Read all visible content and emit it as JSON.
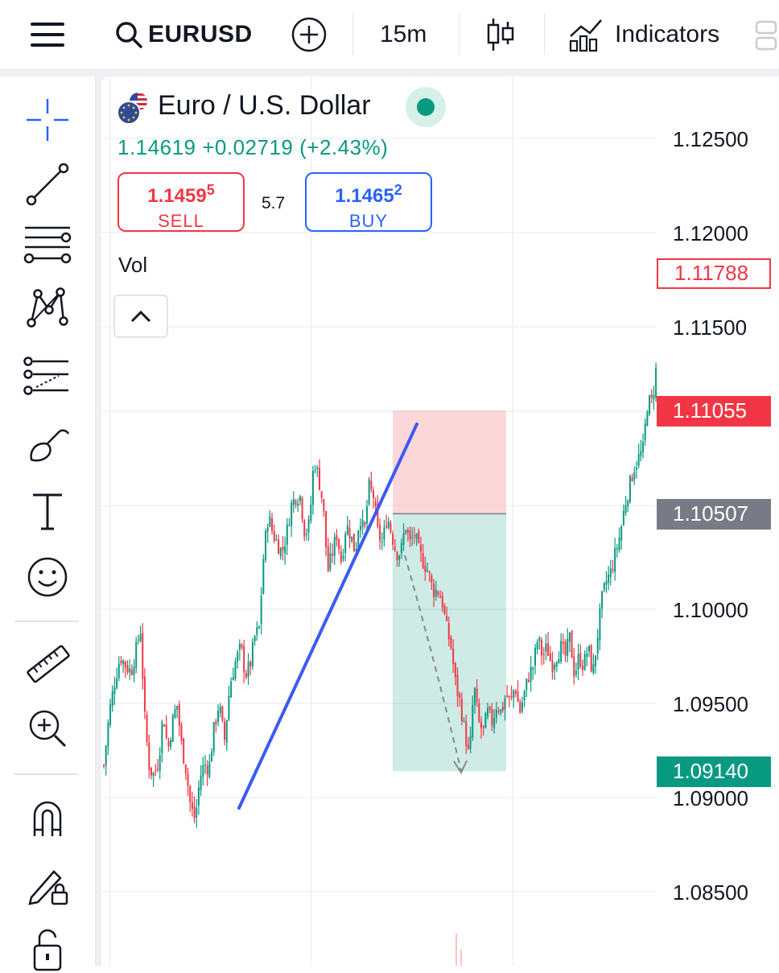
{
  "toolbar": {
    "symbol": "EURUSD",
    "timeframe": "15m",
    "indicators_label": "Indicators"
  },
  "legend": {
    "title": "Euro / U.S. Dollar",
    "last_price": "1.14619",
    "change": "+0.02719",
    "change_pct": "(+2.43%)",
    "price_line": "1.14619  +0.02719 (+2.43%)",
    "status_color": "#089981"
  },
  "order_panel": {
    "sell_price_main": "1.1459",
    "sell_price_pip": "5",
    "sell_label": "SELL",
    "spread": "5.7",
    "buy_price_main": "1.1465",
    "buy_price_pip": "2",
    "buy_label": "BUY",
    "sell_color": "#f23645",
    "buy_color": "#2962ff"
  },
  "volume_label": "Vol",
  "sidebar_tools": [
    "crosshair-icon",
    "trend-line-icon",
    "fib-retracement-icon",
    "xabcd-pattern-icon",
    "gann-fan-icon",
    "brush-icon",
    "text-icon",
    "emoji-icon",
    "ruler-icon",
    "zoom-in-icon",
    "magnet-icon",
    "lock-drawing-icon",
    "unlock-icon"
  ],
  "price_axis": {
    "labels": [
      "1.12500",
      "1.12000",
      "1.11500",
      "1.10000",
      "1.09500",
      "1.09000",
      "1.08500"
    ]
  },
  "price_tags": {
    "current": "1.11788",
    "stop_loss": "1.11055",
    "entry": "1.10507",
    "take_profit": "1.09140"
  },
  "colors": {
    "bull": "#089981",
    "bear": "#f23645",
    "drawing_line": "#3b5bf0"
  },
  "chart_data": {
    "type": "candlestick",
    "symbol": "EURUSD",
    "timeframe": "15m",
    "ylim": [
      1.0825,
      1.1285
    ],
    "ticks": [
      1.125,
      1.12,
      1.115,
      1.1,
      1.095,
      1.09,
      1.085
    ],
    "close_path": [
      [
        0,
        1.0917
      ],
      [
        6,
        1.0945
      ],
      [
        12,
        1.0962
      ],
      [
        18,
        1.0975
      ],
      [
        24,
        1.097
      ],
      [
        30,
        1.0967
      ],
      [
        36,
        1.098
      ],
      [
        40,
        1.099
      ],
      [
        45,
        1.094
      ],
      [
        50,
        1.0915
      ],
      [
        55,
        1.0912
      ],
      [
        60,
        1.092
      ],
      [
        65,
        1.0945
      ],
      [
        70,
        1.0925
      ],
      [
        75,
        1.094
      ],
      [
        80,
        1.095
      ],
      [
        85,
        1.0928
      ],
      [
        90,
        1.0915
      ],
      [
        95,
        1.0895
      ],
      [
        100,
        1.0888
      ],
      [
        105,
        1.091
      ],
      [
        110,
        1.0918
      ],
      [
        115,
        1.0915
      ],
      [
        120,
        1.0935
      ],
      [
        126,
        1.095
      ],
      [
        132,
        1.093
      ],
      [
        138,
        1.096
      ],
      [
        144,
        1.0972
      ],
      [
        150,
        1.098
      ],
      [
        155,
        1.0965
      ],
      [
        160,
        1.097
      ],
      [
        165,
        1.0985
      ],
      [
        170,
        1.099
      ],
      [
        175,
        1.103
      ],
      [
        180,
        1.105
      ],
      [
        185,
        1.104
      ],
      [
        190,
        1.1035
      ],
      [
        195,
        1.103
      ],
      [
        200,
        1.104
      ],
      [
        205,
        1.1055
      ],
      [
        210,
        1.106
      ],
      [
        215,
        1.106
      ],
      [
        220,
        1.104
      ],
      [
        225,
        1.1045
      ],
      [
        230,
        1.108
      ],
      [
        235,
        1.107
      ],
      [
        240,
        1.1055
      ],
      [
        245,
        1.102
      ],
      [
        250,
        1.103
      ],
      [
        255,
        1.104
      ],
      [
        260,
        1.1025
      ],
      [
        265,
        1.1045
      ],
      [
        270,
        1.104
      ],
      [
        275,
        1.103
      ],
      [
        280,
        1.105
      ],
      [
        285,
        1.104
      ],
      [
        290,
        1.1065
      ],
      [
        295,
        1.106
      ],
      [
        300,
        1.104
      ],
      [
        305,
        1.1035
      ],
      [
        310,
        1.105
      ],
      [
        315,
        1.104
      ],
      [
        320,
        1.103
      ],
      [
        325,
        1.103
      ],
      [
        330,
        1.1045
      ],
      [
        335,
        1.1035
      ],
      [
        340,
        1.104
      ],
      [
        345,
        1.103
      ],
      [
        350,
        1.1025
      ],
      [
        355,
        1.102
      ],
      [
        360,
        1.101
      ],
      [
        365,
        1.101
      ],
      [
        370,
        1.1005
      ],
      [
        375,
        1.099
      ],
      [
        380,
        1.098
      ],
      [
        385,
        1.096
      ],
      [
        390,
        1.095
      ],
      [
        395,
        1.0935
      ],
      [
        400,
        1.092
      ],
      [
        405,
        1.096
      ],
      [
        410,
        1.094
      ],
      [
        415,
        1.0935
      ],
      [
        420,
        1.0945
      ],
      [
        425,
        1.094
      ],
      [
        430,
        1.095
      ],
      [
        435,
        1.0945
      ],
      [
        440,
        1.0955
      ],
      [
        445,
        1.095
      ],
      [
        450,
        1.096
      ],
      [
        455,
        1.0945
      ],
      [
        460,
        1.0955
      ],
      [
        465,
        1.0965
      ],
      [
        470,
        1.097
      ],
      [
        475,
        1.0985
      ],
      [
        480,
        1.0975
      ],
      [
        485,
        1.098
      ],
      [
        490,
        1.097
      ],
      [
        495,
        1.0975
      ],
      [
        500,
        1.098
      ],
      [
        505,
        1.0975
      ],
      [
        510,
        1.0985
      ],
      [
        515,
        1.0965
      ],
      [
        520,
        1.0975
      ],
      [
        525,
        1.097
      ],
      [
        530,
        1.098
      ],
      [
        535,
        1.0965
      ],
      [
        540,
        1.0985
      ],
      [
        545,
        1.1005
      ],
      [
        550,
        1.1015
      ],
      [
        555,
        1.102
      ],
      [
        560,
        1.103
      ],
      [
        565,
        1.104
      ],
      [
        570,
        1.1055
      ],
      [
        575,
        1.1065
      ],
      [
        580,
        1.1075
      ],
      [
        585,
        1.108
      ],
      [
        590,
        1.1085
      ],
      [
        595,
        1.111
      ],
      [
        600,
        1.111
      ],
      [
        605,
        1.113
      ],
      [
        610,
        1.1145
      ],
      [
        615,
        1.116
      ],
      [
        620,
        1.1185
      ],
      [
        625,
        1.122
      ],
      [
        630,
        1.1195
      ],
      [
        635,
        1.1188
      ],
      [
        640,
        1.118
      ]
    ],
    "position": {
      "type": "short",
      "entry": 1.10507,
      "stop_loss": 1.11055,
      "take_profit": 1.0914
    },
    "trend_line": {
      "from": [
        1.0895
      ],
      "to": [
        1.11
      ]
    }
  }
}
